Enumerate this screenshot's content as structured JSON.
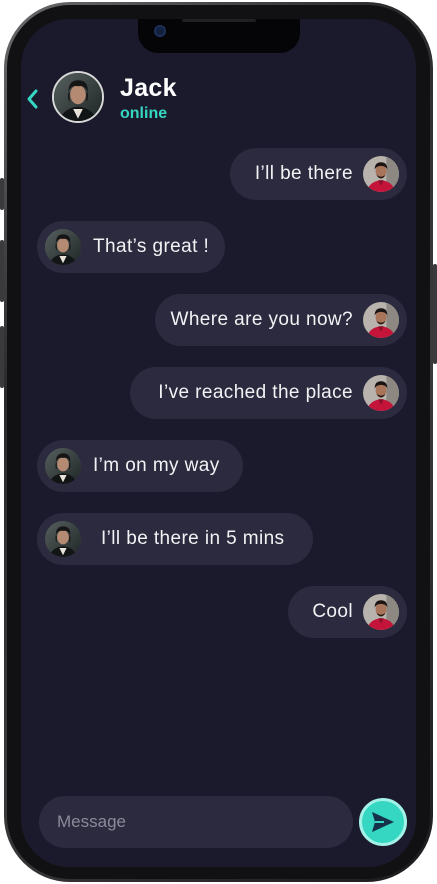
{
  "header": {
    "back_icon": "chevron-left-icon",
    "contact_name": "Jack",
    "status": "online"
  },
  "messages": [
    {
      "side": "sent",
      "text": "I’ll be there"
    },
    {
      "side": "received",
      "text": "That’s great !"
    },
    {
      "side": "sent",
      "text": "Where are you now?"
    },
    {
      "side": "sent",
      "text": "I’ve reached the place"
    },
    {
      "side": "received",
      "text": "I’m on my way"
    },
    {
      "side": "received",
      "text": "I’ll be there in 5 mins"
    },
    {
      "side": "sent",
      "text": "Cool"
    }
  ],
  "composer": {
    "placeholder": "Message",
    "value": "",
    "send_icon": "send-icon"
  },
  "colors": {
    "background": "#1b1a2d",
    "bubble": "#2b2a3e",
    "accent": "#35d6c2",
    "text": "#f2f2f5"
  }
}
